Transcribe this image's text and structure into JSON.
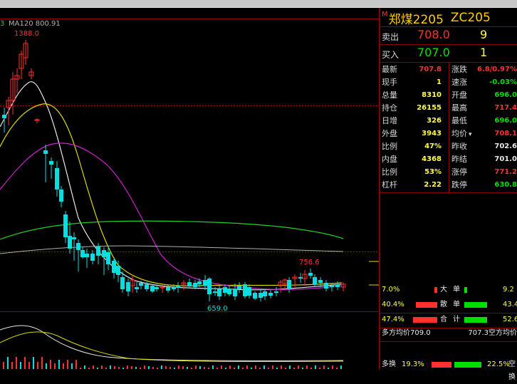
{
  "chart_overlay": {
    "ma_prefix": "3",
    "ma_label": "MA120 800.91",
    "high_label": "1388.0",
    "mid_high_label": "756.6",
    "low_label": "659.0"
  },
  "quote": {
    "title_mark": "M",
    "name": "郑煤2205",
    "code": "ZC205",
    "sell_label": "卖出",
    "sell_price": "708.0",
    "sell_vol": "9",
    "buy_label": "买入",
    "buy_price": "707.0",
    "buy_vol": "1"
  },
  "stats_left": [
    {
      "k": "最新",
      "v": "707.8",
      "c": "red"
    },
    {
      "k": "现手",
      "v": "1",
      "c": "yellow"
    },
    {
      "k": "总量",
      "v": "8310",
      "c": "yellow"
    },
    {
      "k": "持仓",
      "v": "26155",
      "c": "yellow"
    },
    {
      "k": "日增",
      "v": "326",
      "c": "yellow"
    },
    {
      "k": "外盘",
      "v": "3943",
      "c": "yellow"
    },
    {
      "k": "比例",
      "v": "47%",
      "c": "yellow"
    },
    {
      "k": "内盘",
      "v": "4368",
      "c": "yellow"
    },
    {
      "k": "比例",
      "v": "53%",
      "c": "yellow"
    },
    {
      "k": "杠杆",
      "v": "2.22",
      "c": "yellow"
    }
  ],
  "stats_right": [
    {
      "k": "涨跌",
      "v": "6.8/0.97%",
      "c": "red"
    },
    {
      "k": "速涨",
      "v": "-0.03%",
      "c": "green"
    },
    {
      "k": "开盘",
      "v": "696.0",
      "c": "green"
    },
    {
      "k": "最高",
      "v": "717.4",
      "c": "red"
    },
    {
      "k": "最低",
      "v": "696.0",
      "c": "green"
    },
    {
      "k": "均价",
      "v": "708.1",
      "c": "red"
    },
    {
      "k": "昨收",
      "v": "702.6",
      "c": "white"
    },
    {
      "k": "昨结",
      "v": "701.0",
      "c": "white"
    },
    {
      "k": "涨停",
      "v": "771.2",
      "c": "red"
    },
    {
      "k": "跌停",
      "v": "630.8",
      "c": "green"
    }
  ],
  "avg_dropdown": "▾",
  "flow": [
    {
      "pct": "7.0%",
      "lbl1": "大",
      "lbl2": "单",
      "right": "9.2"
    },
    {
      "pct": "40.4%",
      "lbl1": "散",
      "lbl2": "单",
      "right": "43.4"
    },
    {
      "pct": "47.4%",
      "lbl1": "合",
      "lbl2": "计",
      "right": "52.6"
    }
  ],
  "avg_row": {
    "left": "多方均价709.0",
    "right": "707.3空方均价"
  },
  "bottom_row": {
    "left": "多换",
    "left_val": "19.3%",
    "right_val": "22.5%",
    "right": "空换"
  },
  "colors": {
    "up": "#ff3030",
    "down": "#00e0e0",
    "grid": "#8b0000"
  }
}
